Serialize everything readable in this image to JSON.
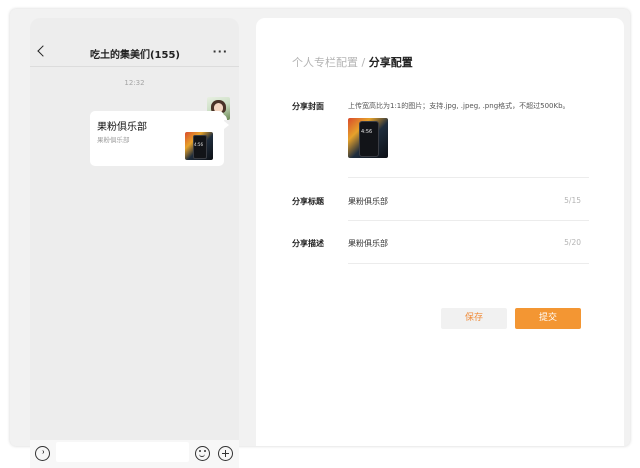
{
  "chat": {
    "title": "吃土的集美们(155)",
    "more": "···",
    "time": "12:32",
    "card": {
      "title": "果粉俱乐部",
      "desc": "果粉俱乐部",
      "thumb_time": "4:56"
    }
  },
  "config": {
    "breadcrumb_parent": "个人专栏配置",
    "breadcrumb_sep": " / ",
    "breadcrumb_current": "分享配置",
    "cover": {
      "label": "分享封面",
      "hint": "上传宽高比为1:1的图片；支持.jpg, .jpeg, .png格式，不超过500Kb。",
      "preview_time": "4:56"
    },
    "title": {
      "label": "分享标题",
      "value": "果粉俱乐部",
      "count": "5/15"
    },
    "desc": {
      "label": "分享描述",
      "value": "果粉俱乐部",
      "count": "5/20"
    },
    "save_label": "保存",
    "submit_label": "提交"
  },
  "colors": {
    "accent": "#f39633",
    "save_text": "#f08c3a",
    "chat_bg": "#ededed"
  }
}
